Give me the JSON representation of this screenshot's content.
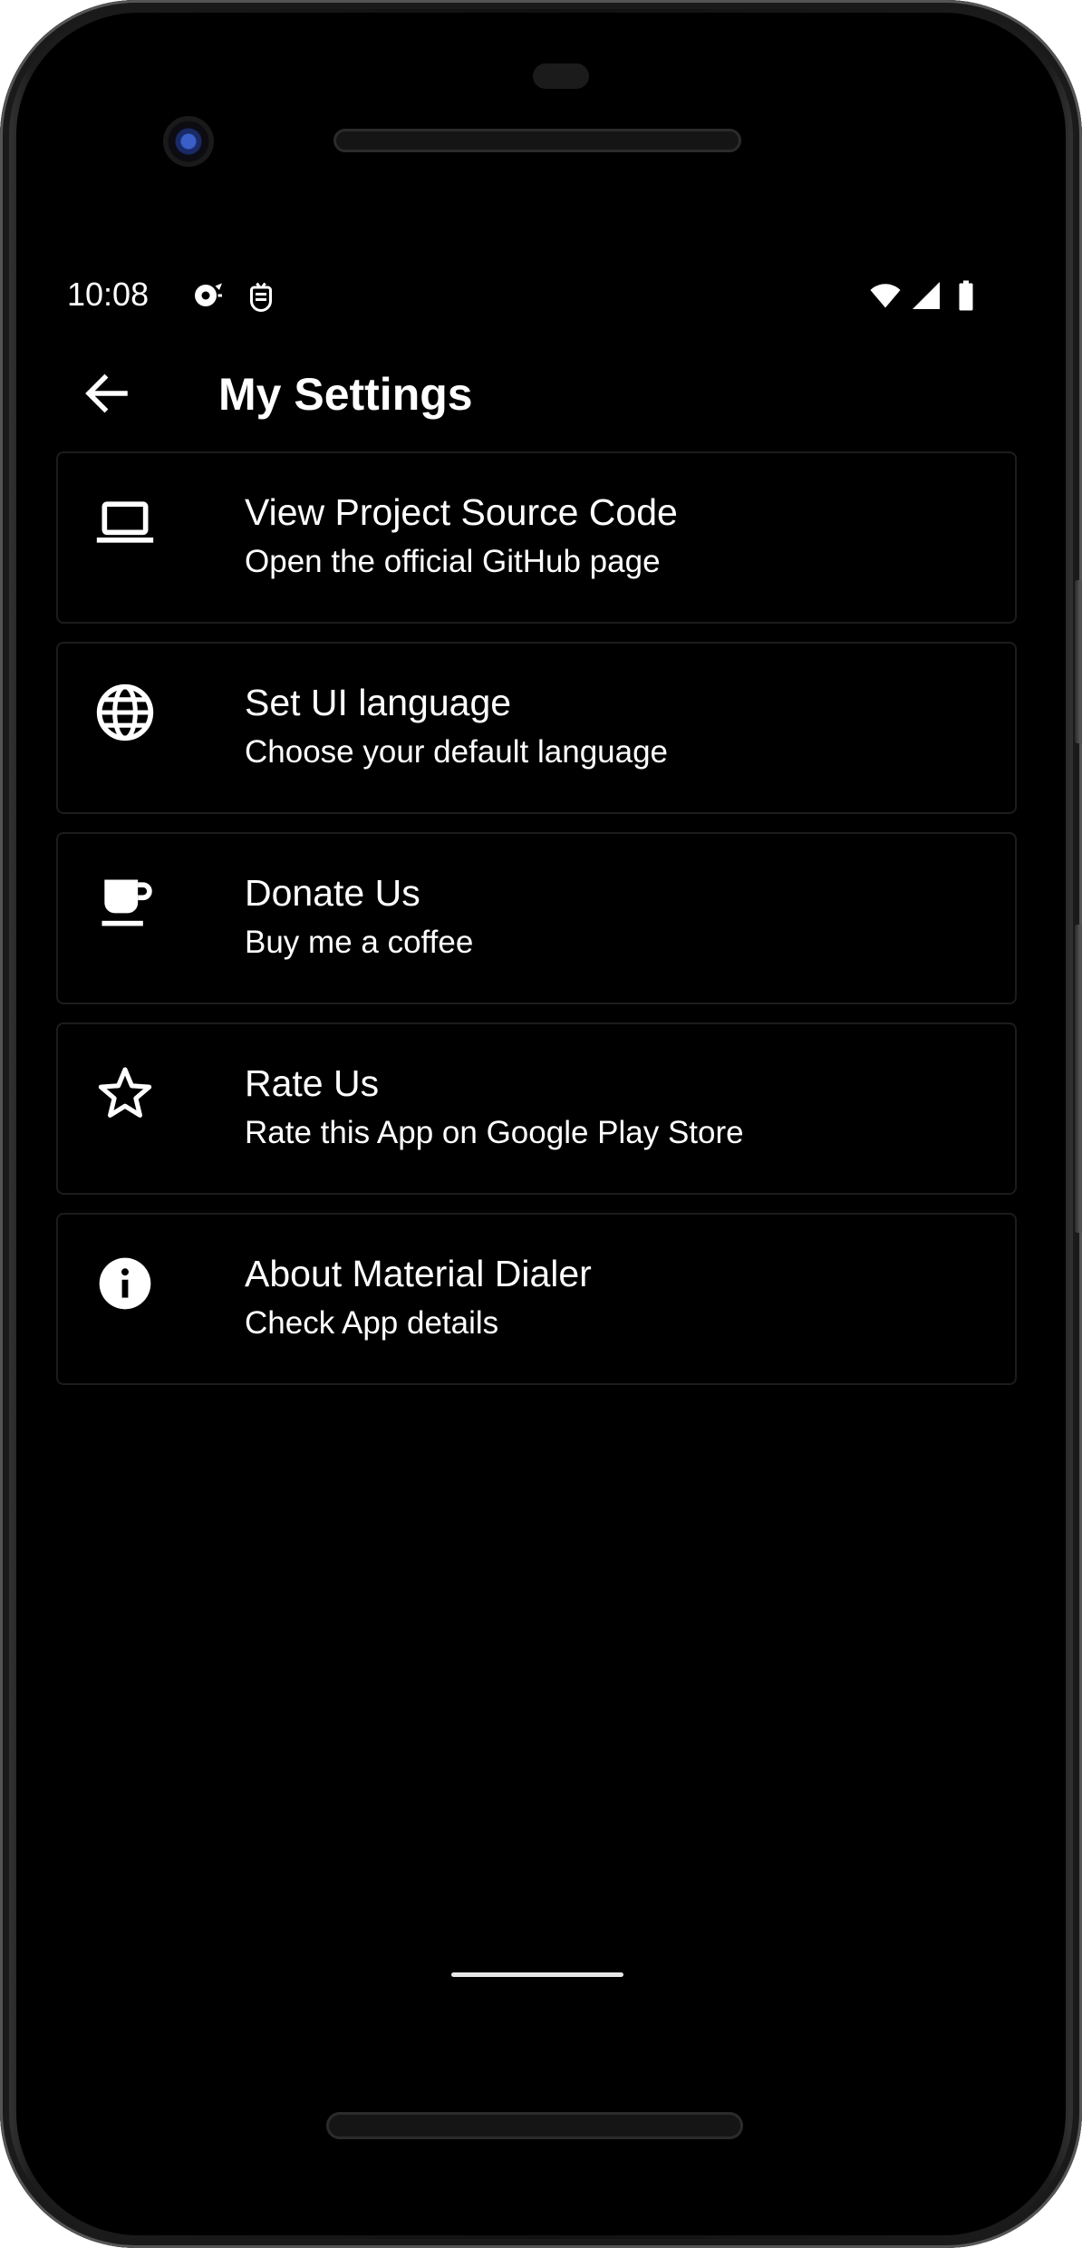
{
  "status_bar": {
    "time": "10:08",
    "left_icons": [
      "notification-bubble-icon",
      "debug-icon"
    ],
    "right_icons": [
      "wifi-icon",
      "cell-signal-icon",
      "battery-icon"
    ]
  },
  "app_bar": {
    "title": "My Settings",
    "back_icon": "arrow-back-icon"
  },
  "settings_items": [
    {
      "icon": "laptop-icon",
      "title": "View Project Source Code",
      "subtitle": "Open the official GitHub page"
    },
    {
      "icon": "globe-icon",
      "title": "Set UI language",
      "subtitle": "Choose your default language"
    },
    {
      "icon": "coffee-cup-icon",
      "title": "Donate Us",
      "subtitle": "Buy me a coffee"
    },
    {
      "icon": "star-outline-icon",
      "title": "Rate Us",
      "subtitle": "Rate this App on Google Play Store"
    },
    {
      "icon": "info-icon",
      "title": "About Material Dialer",
      "subtitle": "Check App details"
    }
  ],
  "colors": {
    "background": "#000000",
    "text": "#ffffff",
    "card_border": "#1c1c1c",
    "device_frame": "#1a1a1a"
  }
}
